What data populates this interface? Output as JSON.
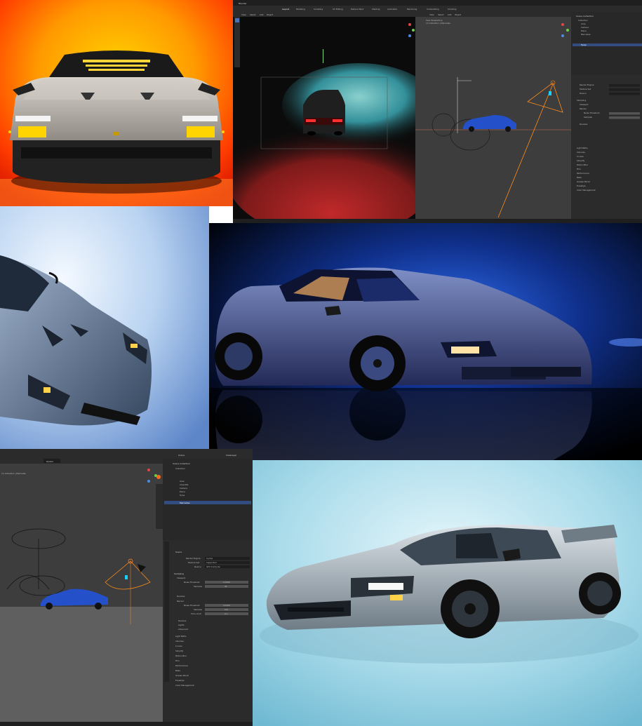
{
  "blender_top": {
    "title_bar": "Blender",
    "header_tabs": [
      "Layout",
      "Modeling",
      "Sculpting",
      "UV Editing",
      "Texture Paint",
      "Shading",
      "Animation",
      "Rendering",
      "Compositing",
      "Scripting"
    ],
    "viewport_left_menu": [
      "View",
      "Select",
      "Add",
      "Object"
    ],
    "viewport_right_menu": [
      "View",
      "Select",
      "Add",
      "Object"
    ],
    "viewport_right_overlay": [
      "User Perspective",
      "(1) Collection | Mercedes"
    ],
    "outliner_title": "Scene Collection",
    "outliner_items": [
      "Collection",
      "Area",
      "Camera",
      "Plane",
      "Mercedes",
      "Tyres"
    ],
    "properties_items": [
      "Render Engine",
      "Feature Set",
      "Device",
      "Sampling",
      "Viewport",
      "Render",
      "Noise Threshold",
      "Samples",
      "Denoise",
      "Light Paths",
      "Volumes",
      "Curves",
      "Simplify",
      "Motion Blur",
      "Film",
      "Performance",
      "Bake",
      "Grease Pencil",
      "Freestyle",
      "Color Management"
    ]
  },
  "blender_bottom": {
    "menu": [
      "View",
      "Select",
      "Add",
      "Object"
    ],
    "mode": "Object Mode",
    "global": "Global",
    "scene": "Scene",
    "view_layer": "ViewLayer",
    "overlay_text": [
      "User Perspective",
      "(1) Collection | Mercedes"
    ],
    "outliner": {
      "title": "Scene Collection",
      "items": [
        "Collection",
        "Area",
        "Area.001",
        "Camera",
        "Plane",
        "Tyres",
        "Mercedes"
      ]
    },
    "properties": {
      "scene_label": "Scene",
      "render_engine_label": "Render Engine",
      "render_engine_value": "Cycles",
      "feature_set_label": "Feature Set",
      "feature_set_value": "Supported",
      "device_label": "Device",
      "device_value": "GPU Compute",
      "sampling": "Sampling",
      "viewport": "Viewport",
      "noise_threshold_label": "Noise Threshold",
      "noise_threshold_value": "0.1000",
      "samples_label": "Samples",
      "viewport_samples_value": "32",
      "denoise": "Denoise",
      "render": "Render",
      "render_noise_threshold_value": "0.0100",
      "render_samples_value": "512",
      "time_limit_label": "Time Limit",
      "time_limit_value": "0 s",
      "lights": "Lights",
      "advanced": "Advanced",
      "sections": [
        "Light Paths",
        "Volumes",
        "Curves",
        "Simplify",
        "Motion Blur",
        "Film",
        "Performance",
        "Bake",
        "Grease Pencil",
        "Freestyle",
        "Color Management"
      ]
    }
  },
  "colors": {
    "blender_bg": "#3d3d3d",
    "blender_panel": "#2b2b2b",
    "selection": "#334d80",
    "orange_select": "#ff8c1a",
    "car_blue": "#2451c9",
    "sky_blue": "#9fd4e8"
  },
  "icons": [
    "camera-icon",
    "light-icon",
    "eye-icon",
    "render-icon"
  ]
}
